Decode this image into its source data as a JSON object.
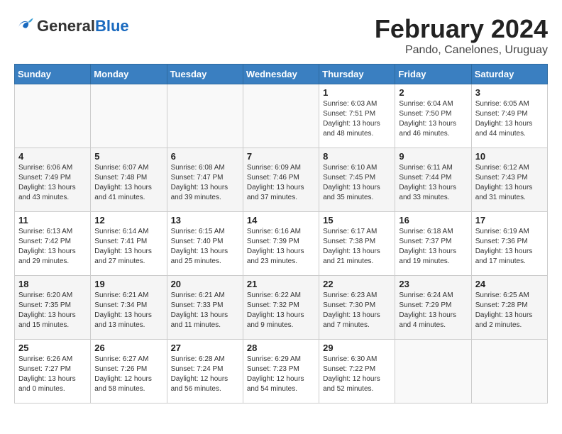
{
  "header": {
    "logo_general": "General",
    "logo_blue": "Blue",
    "month_year": "February 2024",
    "location": "Pando, Canelones, Uruguay"
  },
  "days_of_week": [
    "Sunday",
    "Monday",
    "Tuesday",
    "Wednesday",
    "Thursday",
    "Friday",
    "Saturday"
  ],
  "weeks": [
    [
      {
        "day": "",
        "info": ""
      },
      {
        "day": "",
        "info": ""
      },
      {
        "day": "",
        "info": ""
      },
      {
        "day": "",
        "info": ""
      },
      {
        "day": "1",
        "info": "Sunrise: 6:03 AM\nSunset: 7:51 PM\nDaylight: 13 hours\nand 48 minutes."
      },
      {
        "day": "2",
        "info": "Sunrise: 6:04 AM\nSunset: 7:50 PM\nDaylight: 13 hours\nand 46 minutes."
      },
      {
        "day": "3",
        "info": "Sunrise: 6:05 AM\nSunset: 7:49 PM\nDaylight: 13 hours\nand 44 minutes."
      }
    ],
    [
      {
        "day": "4",
        "info": "Sunrise: 6:06 AM\nSunset: 7:49 PM\nDaylight: 13 hours\nand 43 minutes."
      },
      {
        "day": "5",
        "info": "Sunrise: 6:07 AM\nSunset: 7:48 PM\nDaylight: 13 hours\nand 41 minutes."
      },
      {
        "day": "6",
        "info": "Sunrise: 6:08 AM\nSunset: 7:47 PM\nDaylight: 13 hours\nand 39 minutes."
      },
      {
        "day": "7",
        "info": "Sunrise: 6:09 AM\nSunset: 7:46 PM\nDaylight: 13 hours\nand 37 minutes."
      },
      {
        "day": "8",
        "info": "Sunrise: 6:10 AM\nSunset: 7:45 PM\nDaylight: 13 hours\nand 35 minutes."
      },
      {
        "day": "9",
        "info": "Sunrise: 6:11 AM\nSunset: 7:44 PM\nDaylight: 13 hours\nand 33 minutes."
      },
      {
        "day": "10",
        "info": "Sunrise: 6:12 AM\nSunset: 7:43 PM\nDaylight: 13 hours\nand 31 minutes."
      }
    ],
    [
      {
        "day": "11",
        "info": "Sunrise: 6:13 AM\nSunset: 7:42 PM\nDaylight: 13 hours\nand 29 minutes."
      },
      {
        "day": "12",
        "info": "Sunrise: 6:14 AM\nSunset: 7:41 PM\nDaylight: 13 hours\nand 27 minutes."
      },
      {
        "day": "13",
        "info": "Sunrise: 6:15 AM\nSunset: 7:40 PM\nDaylight: 13 hours\nand 25 minutes."
      },
      {
        "day": "14",
        "info": "Sunrise: 6:16 AM\nSunset: 7:39 PM\nDaylight: 13 hours\nand 23 minutes."
      },
      {
        "day": "15",
        "info": "Sunrise: 6:17 AM\nSunset: 7:38 PM\nDaylight: 13 hours\nand 21 minutes."
      },
      {
        "day": "16",
        "info": "Sunrise: 6:18 AM\nSunset: 7:37 PM\nDaylight: 13 hours\nand 19 minutes."
      },
      {
        "day": "17",
        "info": "Sunrise: 6:19 AM\nSunset: 7:36 PM\nDaylight: 13 hours\nand 17 minutes."
      }
    ],
    [
      {
        "day": "18",
        "info": "Sunrise: 6:20 AM\nSunset: 7:35 PM\nDaylight: 13 hours\nand 15 minutes."
      },
      {
        "day": "19",
        "info": "Sunrise: 6:21 AM\nSunset: 7:34 PM\nDaylight: 13 hours\nand 13 minutes."
      },
      {
        "day": "20",
        "info": "Sunrise: 6:21 AM\nSunset: 7:33 PM\nDaylight: 13 hours\nand 11 minutes."
      },
      {
        "day": "21",
        "info": "Sunrise: 6:22 AM\nSunset: 7:32 PM\nDaylight: 13 hours\nand 9 minutes."
      },
      {
        "day": "22",
        "info": "Sunrise: 6:23 AM\nSunset: 7:30 PM\nDaylight: 13 hours\nand 7 minutes."
      },
      {
        "day": "23",
        "info": "Sunrise: 6:24 AM\nSunset: 7:29 PM\nDaylight: 13 hours\nand 4 minutes."
      },
      {
        "day": "24",
        "info": "Sunrise: 6:25 AM\nSunset: 7:28 PM\nDaylight: 13 hours\nand 2 minutes."
      }
    ],
    [
      {
        "day": "25",
        "info": "Sunrise: 6:26 AM\nSunset: 7:27 PM\nDaylight: 13 hours\nand 0 minutes."
      },
      {
        "day": "26",
        "info": "Sunrise: 6:27 AM\nSunset: 7:26 PM\nDaylight: 12 hours\nand 58 minutes."
      },
      {
        "day": "27",
        "info": "Sunrise: 6:28 AM\nSunset: 7:24 PM\nDaylight: 12 hours\nand 56 minutes."
      },
      {
        "day": "28",
        "info": "Sunrise: 6:29 AM\nSunset: 7:23 PM\nDaylight: 12 hours\nand 54 minutes."
      },
      {
        "day": "29",
        "info": "Sunrise: 6:30 AM\nSunset: 7:22 PM\nDaylight: 12 hours\nand 52 minutes."
      },
      {
        "day": "",
        "info": ""
      },
      {
        "day": "",
        "info": ""
      }
    ]
  ]
}
